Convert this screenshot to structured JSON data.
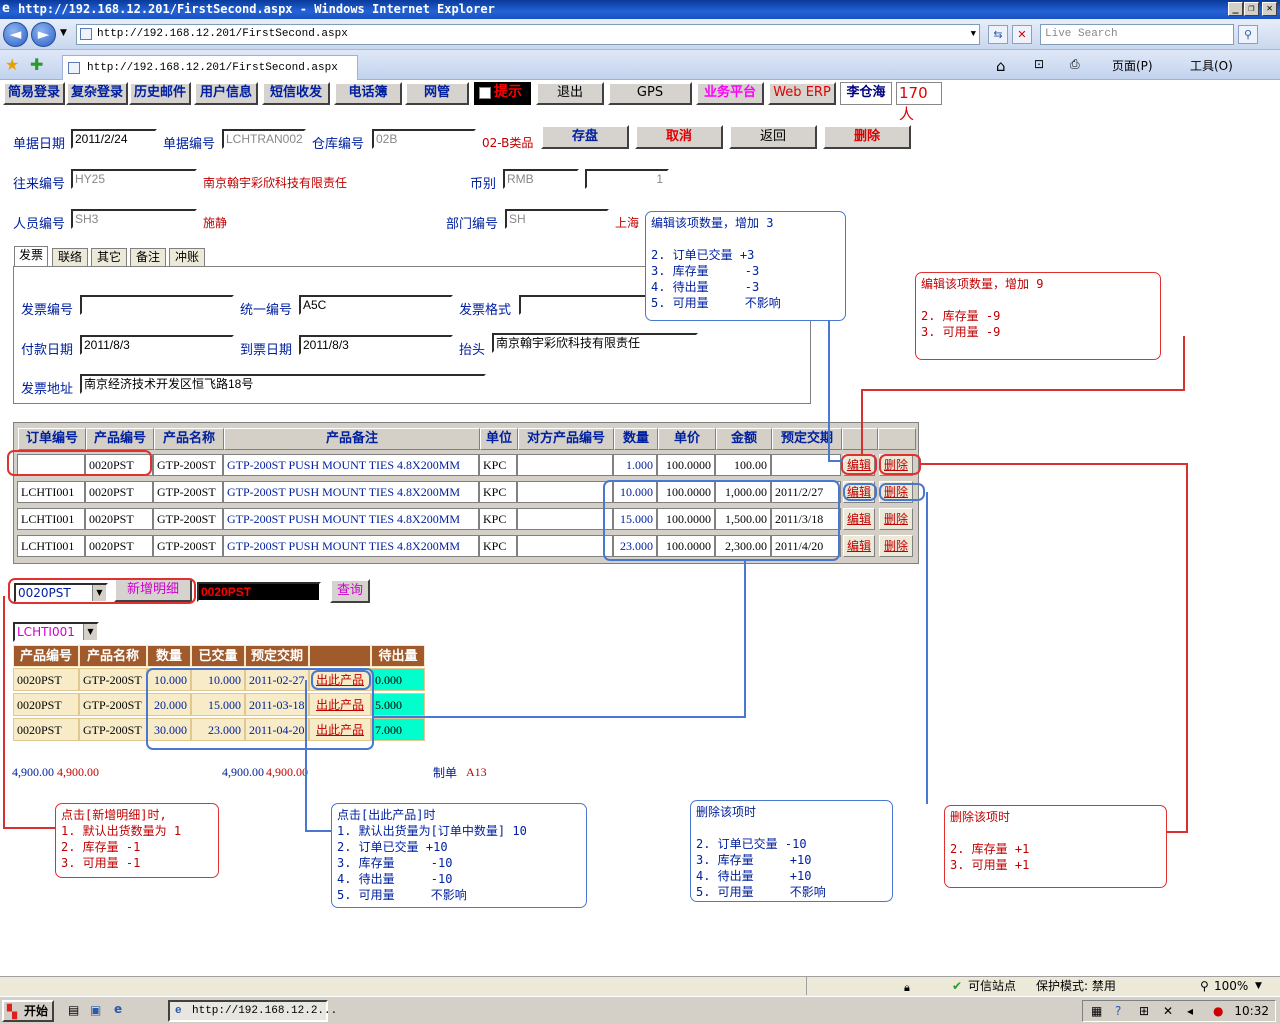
{
  "browser": {
    "title": "http://192.168.12.201/FirstSecond.aspx - Windows Internet Explorer",
    "address": "http://192.168.12.201/FirstSecond.aspx",
    "search_placeholder": "Live Search",
    "tab_title": "http://192.168.12.201/FirstSecond.aspx",
    "cmd_page": "页面(P)",
    "cmd_tools": "工具(O)"
  },
  "menu": {
    "items": [
      "简易登录",
      "复杂登录",
      "历史邮件",
      "用户信息",
      "短信收发",
      "电话簿",
      "网管"
    ],
    "hint": "提示",
    "exit": "退出",
    "gps": "GPS",
    "platform": "业务平台",
    "web_erp": "Web ERP",
    "user": "李仓海",
    "count": "170人"
  },
  "form": {
    "date_label": "单据日期",
    "date": "2011/2/24",
    "doc_no_label": "单据编号",
    "doc_no": "LCHTRAN002",
    "warehouse_label": "仓库编号",
    "warehouse": "02B",
    "warehouse_name": "02-B类品",
    "btn_save": "存盘",
    "btn_cancel": "取消",
    "btn_back": "返回",
    "btn_delete": "删除",
    "partner_label": "往来编号",
    "partner": "HY25",
    "partner_name": "南京翰宇彩欣科技有限责任",
    "currency_label": "币别",
    "currency": "RMB",
    "rate": "1",
    "staff_label": "人员编号",
    "staff": "SH3",
    "staff_name": "施静",
    "dept_label": "部门编号",
    "dept": "SH",
    "dept_name": "上海"
  },
  "tabs": [
    "发票",
    "联络",
    "其它",
    "备注",
    "冲账"
  ],
  "invoice": {
    "inv_no_label": "发票编号",
    "inv_no": "",
    "unified_label": "统一编号",
    "unified": "A5C",
    "format_label": "发票格式",
    "pay_date_label": "付款日期",
    "pay_date": "2011/8/3",
    "arrive_date_label": "到票日期",
    "arrive_date": "2011/8/3",
    "header_label": "抬头",
    "header": "南京翰宇彩欣科技有限责任",
    "address_label": "发票地址",
    "address": "南京经济技术开发区恒飞路18号"
  },
  "detail": {
    "headers": [
      "订单编号",
      "产品编号",
      "产品名称",
      "产品备注",
      "单位",
      "对方产品编号",
      "数量",
      "单价",
      "金额",
      "预定交期"
    ],
    "edit": "编辑",
    "remove": "删除",
    "rows": [
      [
        "",
        "0020PST",
        "GTP-200ST",
        "GTP-200ST PUSH MOUNT TIES 4.8X200MM",
        "KPC",
        "",
        "1.000",
        "100.0000",
        "100.00",
        ""
      ],
      [
        "LCHTI001",
        "0020PST",
        "GTP-200ST",
        "GTP-200ST PUSH MOUNT TIES 4.8X200MM",
        "KPC",
        "",
        "10.000",
        "100.0000",
        "1,000.00",
        "2011/2/27"
      ],
      [
        "LCHTI001",
        "0020PST",
        "GTP-200ST",
        "GTP-200ST PUSH MOUNT TIES 4.8X200MM",
        "KPC",
        "",
        "15.000",
        "100.0000",
        "1,500.00",
        "2011/3/18"
      ],
      [
        "LCHTI001",
        "0020PST",
        "GTP-200ST",
        "GTP-200ST PUSH MOUNT TIES 4.8X200MM",
        "KPC",
        "",
        "23.000",
        "100.0000",
        "2,300.00",
        "2011/4/20"
      ]
    ]
  },
  "add": {
    "product": "0020PST",
    "btn_add": "新增明细",
    "search_value": "0020PST",
    "btn_query": "查询"
  },
  "order": {
    "selected": "LCHTI001",
    "headers": [
      "产品编号",
      "产品名称",
      "数量",
      "已交量",
      "预定交期",
      "",
      "待出量"
    ],
    "ship": "出此产品",
    "rows": [
      [
        "0020PST",
        "GTP-200ST",
        "10.000",
        "10.000",
        "2011-02-27",
        "0.000"
      ],
      [
        "0020PST",
        "GTP-200ST",
        "20.000",
        "15.000",
        "2011-03-18",
        "5.000"
      ],
      [
        "0020PST",
        "GTP-200ST",
        "30.000",
        "23.000",
        "2011-04-20",
        "7.000"
      ]
    ]
  },
  "totals": {
    "a1": "4,900.00",
    "a2": "4,900.00",
    "b1": "4,900.00",
    "b2": "4,900.00",
    "maker_label": "制单",
    "maker": "A13"
  },
  "notes": {
    "edit3": "编辑该项数量，增加 3\n\n2. 订单已交量 +3\n3. 库存量     -3\n4. 待出量     -3\n5. 可用量     不影响",
    "edit9": "编辑该项数量，增加 9\n\n2. 库存量 -9\n3. 可用量 -9",
    "add_detail": "点击[新增明细]时,\n1. 默认出货数量为 1\n2. 库存量 -1\n3. 可用量 -1",
    "ship": "点击[出此产品]时\n1. 默认出货量为[订单中数量] 10\n2. 订单已交量 +10\n3. 库存量     -10\n4. 待出量     -10\n5. 可用量     不影响",
    "del_order": "删除该项时\n\n2. 订单已交量 -10\n3. 库存量     +10\n4. 待出量     +10\n5. 可用量     不影响",
    "del_plain": "删除该项时\n\n2. 库存量 +1\n3. 可用量 +1"
  },
  "status": {
    "zone": "可信站点",
    "mode": "保护模式: 禁用",
    "zoom": "100%"
  },
  "taskbar": {
    "start": "开始",
    "task": "http://192.168.12.2...",
    "time": "10:32"
  }
}
